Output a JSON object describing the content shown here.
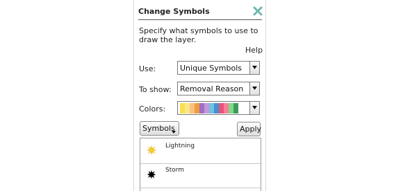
{
  "panel": {
    "title": "Change Symbols",
    "description": "Specify what symbols to use to draw the layer.",
    "help_label": "Help"
  },
  "use": {
    "label": "Use:",
    "value": "Unique Symbols"
  },
  "to_show": {
    "label": "To show:",
    "value": "Removal Reason"
  },
  "colors": {
    "label": "Colors:",
    "palette": [
      "#f9e14b",
      "#fae68a",
      "#f8c27e",
      "#f29b3c",
      "#9f6fc4",
      "#c596dc",
      "#6fc3e1",
      "#4690d1",
      "#e8517a",
      "#f47f96",
      "#7fd98b",
      "#3f9a5a"
    ]
  },
  "buttons": {
    "symbols_label": "Symbols",
    "apply_label": "Apply"
  },
  "symbol_list": [
    {
      "label": "Lightning",
      "icon": "lightning-sun-icon"
    },
    {
      "label": "Storm",
      "icon": "storm-splat-icon"
    }
  ]
}
